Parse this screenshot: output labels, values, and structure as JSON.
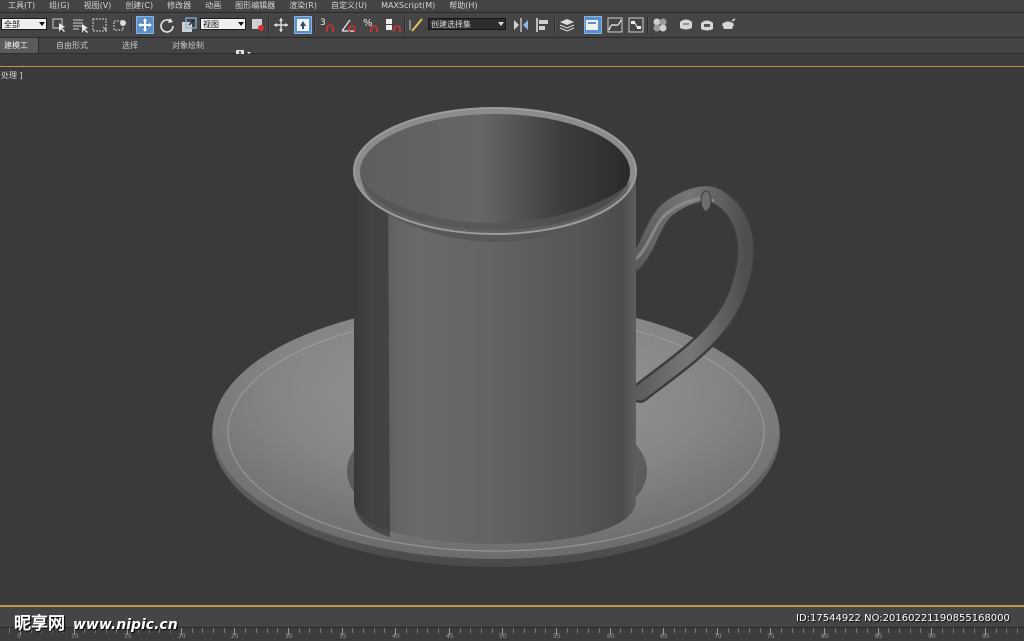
{
  "menubar": {
    "items": [
      "工具(T)",
      "组(G)",
      "视图(V)",
      "创建(C)",
      "修改器",
      "动画",
      "图形编辑器",
      "渲染(R)",
      "自定义(U)",
      "MAXScript(M)",
      "帮助(H)"
    ]
  },
  "toolbar": {
    "selection_filter": "全部",
    "reference_coord": "视图",
    "snap_labels": [
      "3",
      "%",
      "n"
    ],
    "named_selection_set": "创建选择集"
  },
  "ribbon": {
    "tabs": [
      "建模工具",
      "自由形式",
      "选择",
      "对象绘制"
    ]
  },
  "viewport": {
    "label": "处理 ]",
    "active_border_color": "#b79b46",
    "background_color": "#3a3a3a"
  },
  "timeline": {
    "tick_labels": [
      "5",
      "10",
      "15",
      "20",
      "25",
      "30",
      "35",
      "40",
      "45",
      "50",
      "55",
      "60",
      "65",
      "70",
      "75",
      "80",
      "85",
      "90",
      "95"
    ]
  },
  "watermark": {
    "brand": "昵享网",
    "site": "www.nipic.cn",
    "id_text": "ID:17544922 NO:20160221190855168000"
  }
}
